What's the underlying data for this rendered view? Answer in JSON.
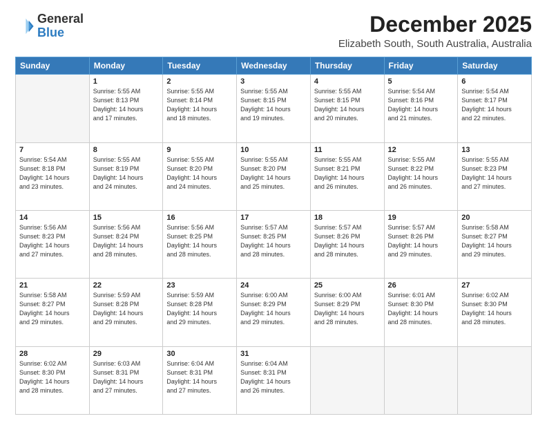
{
  "header": {
    "logo_general": "General",
    "logo_blue": "Blue",
    "month_title": "December 2025",
    "location": "Elizabeth South, South Australia, Australia"
  },
  "days_of_week": [
    "Sunday",
    "Monday",
    "Tuesday",
    "Wednesday",
    "Thursday",
    "Friday",
    "Saturday"
  ],
  "weeks": [
    [
      {
        "day": "",
        "info": ""
      },
      {
        "day": "1",
        "info": "Sunrise: 5:55 AM\nSunset: 8:13 PM\nDaylight: 14 hours\nand 17 minutes."
      },
      {
        "day": "2",
        "info": "Sunrise: 5:55 AM\nSunset: 8:14 PM\nDaylight: 14 hours\nand 18 minutes."
      },
      {
        "day": "3",
        "info": "Sunrise: 5:55 AM\nSunset: 8:15 PM\nDaylight: 14 hours\nand 19 minutes."
      },
      {
        "day": "4",
        "info": "Sunrise: 5:55 AM\nSunset: 8:15 PM\nDaylight: 14 hours\nand 20 minutes."
      },
      {
        "day": "5",
        "info": "Sunrise: 5:54 AM\nSunset: 8:16 PM\nDaylight: 14 hours\nand 21 minutes."
      },
      {
        "day": "6",
        "info": "Sunrise: 5:54 AM\nSunset: 8:17 PM\nDaylight: 14 hours\nand 22 minutes."
      }
    ],
    [
      {
        "day": "7",
        "info": "Sunrise: 5:54 AM\nSunset: 8:18 PM\nDaylight: 14 hours\nand 23 minutes."
      },
      {
        "day": "8",
        "info": "Sunrise: 5:55 AM\nSunset: 8:19 PM\nDaylight: 14 hours\nand 24 minutes."
      },
      {
        "day": "9",
        "info": "Sunrise: 5:55 AM\nSunset: 8:20 PM\nDaylight: 14 hours\nand 24 minutes."
      },
      {
        "day": "10",
        "info": "Sunrise: 5:55 AM\nSunset: 8:20 PM\nDaylight: 14 hours\nand 25 minutes."
      },
      {
        "day": "11",
        "info": "Sunrise: 5:55 AM\nSunset: 8:21 PM\nDaylight: 14 hours\nand 26 minutes."
      },
      {
        "day": "12",
        "info": "Sunrise: 5:55 AM\nSunset: 8:22 PM\nDaylight: 14 hours\nand 26 minutes."
      },
      {
        "day": "13",
        "info": "Sunrise: 5:55 AM\nSunset: 8:23 PM\nDaylight: 14 hours\nand 27 minutes."
      }
    ],
    [
      {
        "day": "14",
        "info": "Sunrise: 5:56 AM\nSunset: 8:23 PM\nDaylight: 14 hours\nand 27 minutes."
      },
      {
        "day": "15",
        "info": "Sunrise: 5:56 AM\nSunset: 8:24 PM\nDaylight: 14 hours\nand 28 minutes."
      },
      {
        "day": "16",
        "info": "Sunrise: 5:56 AM\nSunset: 8:25 PM\nDaylight: 14 hours\nand 28 minutes."
      },
      {
        "day": "17",
        "info": "Sunrise: 5:57 AM\nSunset: 8:25 PM\nDaylight: 14 hours\nand 28 minutes."
      },
      {
        "day": "18",
        "info": "Sunrise: 5:57 AM\nSunset: 8:26 PM\nDaylight: 14 hours\nand 28 minutes."
      },
      {
        "day": "19",
        "info": "Sunrise: 5:57 AM\nSunset: 8:26 PM\nDaylight: 14 hours\nand 29 minutes."
      },
      {
        "day": "20",
        "info": "Sunrise: 5:58 AM\nSunset: 8:27 PM\nDaylight: 14 hours\nand 29 minutes."
      }
    ],
    [
      {
        "day": "21",
        "info": "Sunrise: 5:58 AM\nSunset: 8:27 PM\nDaylight: 14 hours\nand 29 minutes."
      },
      {
        "day": "22",
        "info": "Sunrise: 5:59 AM\nSunset: 8:28 PM\nDaylight: 14 hours\nand 29 minutes."
      },
      {
        "day": "23",
        "info": "Sunrise: 5:59 AM\nSunset: 8:28 PM\nDaylight: 14 hours\nand 29 minutes."
      },
      {
        "day": "24",
        "info": "Sunrise: 6:00 AM\nSunset: 8:29 PM\nDaylight: 14 hours\nand 29 minutes."
      },
      {
        "day": "25",
        "info": "Sunrise: 6:00 AM\nSunset: 8:29 PM\nDaylight: 14 hours\nand 28 minutes."
      },
      {
        "day": "26",
        "info": "Sunrise: 6:01 AM\nSunset: 8:30 PM\nDaylight: 14 hours\nand 28 minutes."
      },
      {
        "day": "27",
        "info": "Sunrise: 6:02 AM\nSunset: 8:30 PM\nDaylight: 14 hours\nand 28 minutes."
      }
    ],
    [
      {
        "day": "28",
        "info": "Sunrise: 6:02 AM\nSunset: 8:30 PM\nDaylight: 14 hours\nand 28 minutes."
      },
      {
        "day": "29",
        "info": "Sunrise: 6:03 AM\nSunset: 8:31 PM\nDaylight: 14 hours\nand 27 minutes."
      },
      {
        "day": "30",
        "info": "Sunrise: 6:04 AM\nSunset: 8:31 PM\nDaylight: 14 hours\nand 27 minutes."
      },
      {
        "day": "31",
        "info": "Sunrise: 6:04 AM\nSunset: 8:31 PM\nDaylight: 14 hours\nand 26 minutes."
      },
      {
        "day": "",
        "info": ""
      },
      {
        "day": "",
        "info": ""
      },
      {
        "day": "",
        "info": ""
      }
    ]
  ]
}
